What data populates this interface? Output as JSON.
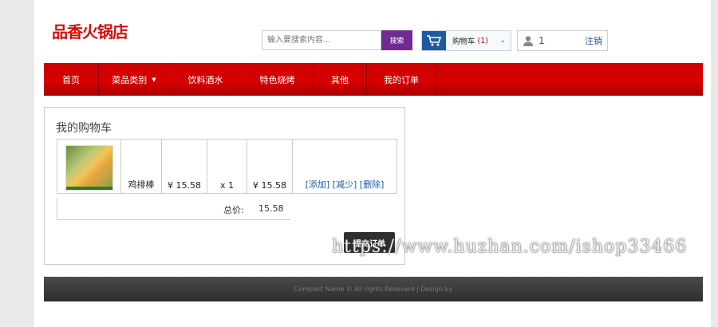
{
  "header": {
    "logo": "品香火锅店",
    "search_placeholder": "输入要搜索内容...",
    "search_button": "搜索",
    "cart_label": "购物车",
    "cart_count": "(1)",
    "user_name": "1",
    "logout": "注销"
  },
  "nav": [
    {
      "label": "首页"
    },
    {
      "label": "菜品类别"
    },
    {
      "label": "饮料酒水"
    },
    {
      "label": "特色烧烤"
    },
    {
      "label": "其他"
    },
    {
      "label": "我的订单"
    }
  ],
  "cart": {
    "title": "我的购物车",
    "items": [
      {
        "name": "鸡排棒",
        "price": "¥ 15.58",
        "qty": "x 1",
        "subtotal": "¥ 15.58",
        "add": "[添加]",
        "reduce": "[减少]",
        "remove": "[删除]"
      }
    ],
    "total_label": "总价:",
    "total_value": "15.58",
    "submit": "提交订单"
  },
  "footer": {
    "text": "Compant Name © All rights Reseverd | Design by"
  },
  "watermark": "https://www.huzhan.com/ishop33466",
  "colors": {
    "accent": "#d60d0d",
    "nav": "#cc0000",
    "search_btn": "#6f2a93",
    "link": "#1e5aa0"
  }
}
